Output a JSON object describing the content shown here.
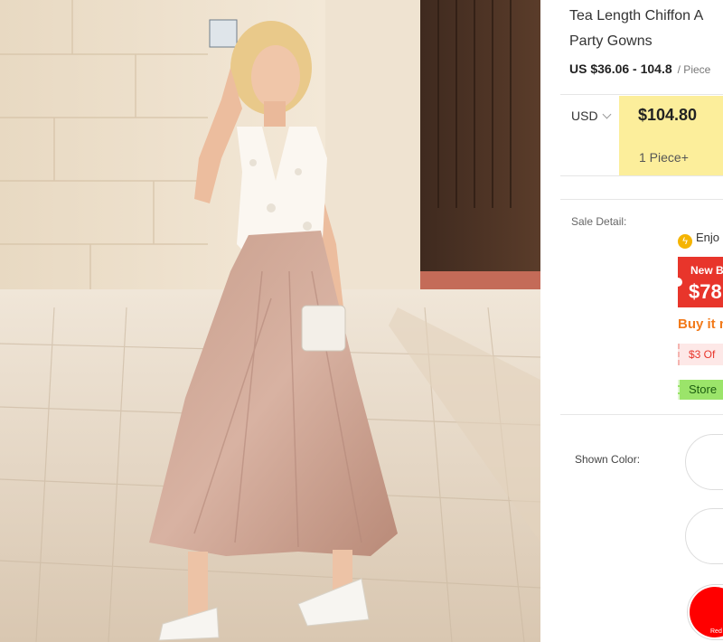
{
  "product": {
    "title_line1": "Tea Length Chiffon A",
    "title_line2": "Party Gowns",
    "price_range": "US $36.06 - 104.8",
    "price_unit": "/ Piece"
  },
  "pricing": {
    "currency": "USD",
    "tier_price": "$104.80",
    "tier_qty": "1 Piece+"
  },
  "sale": {
    "label": "Sale Detail:",
    "enjoy_text": "Enjo",
    "bolt_icon": "lightning-icon",
    "new_line1": "New B",
    "new_line2": "$78",
    "buy_text": "Buy it n",
    "coupon_text": "$3  Of",
    "store_text": "Store"
  },
  "colors": {
    "label": "Shown Color:",
    "swatch_red_name": "Red",
    "accent_red": "#e8352b",
    "accent_yellow": "#fcee9b",
    "accent_green": "#9be46a",
    "accent_orange": "#f27a1a"
  }
}
